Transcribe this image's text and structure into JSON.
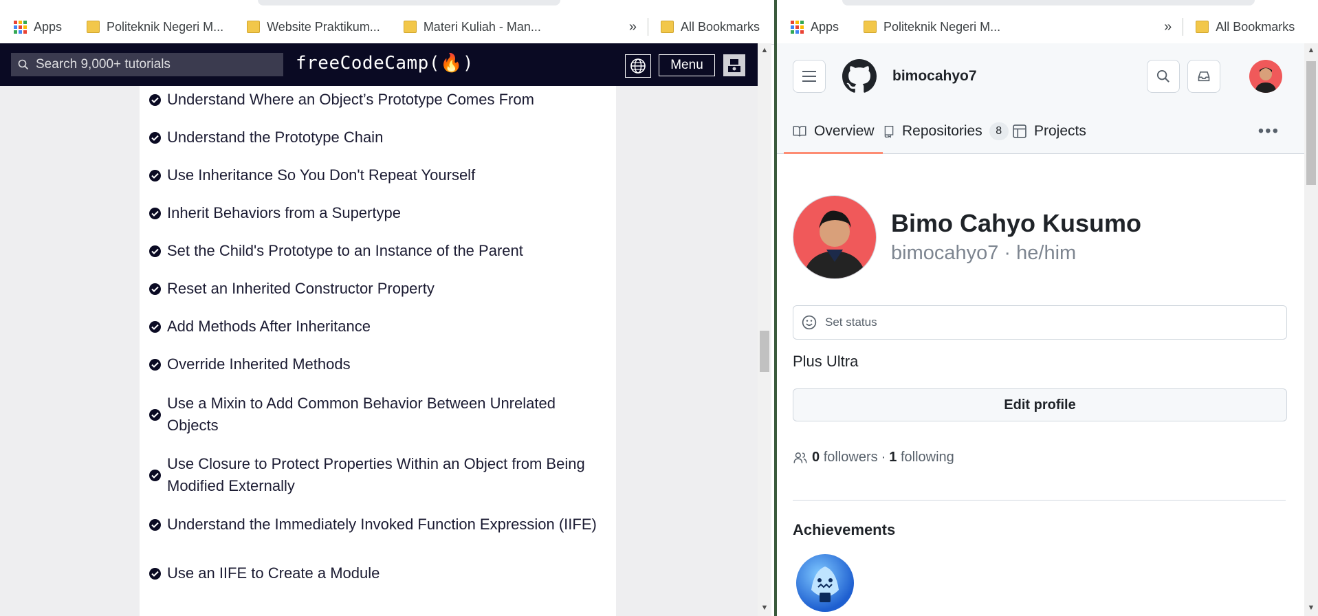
{
  "left_window": {
    "bookmarks": {
      "apps_label": "Apps",
      "items": [
        "Politeknik Negeri M...",
        "Website Praktikum...",
        "Materi Kuliah - Man..."
      ],
      "overflow": "»",
      "all_bookmarks": "All Bookmarks"
    },
    "fcc": {
      "search_placeholder": "Search 9,000+ tutorials",
      "logo_text": "freeCodeCamp(🔥)",
      "menu_label": "Menu",
      "lessons": [
        "Understand Where an Object’s Prototype Comes From",
        "Understand the Prototype Chain",
        "Use Inheritance So You Don't Repeat Yourself",
        "Inherit Behaviors from a Supertype",
        "Set the Child's Prototype to an Instance of the Parent",
        "Reset an Inherited Constructor Property",
        "Add Methods After Inheritance",
        "Override Inherited Methods",
        "Use a Mixin to Add Common Behavior Between Unrelated Objects",
        "Use Closure to Protect Properties Within an Object from Being Modified Externally",
        "Understand the Immediately Invoked Function Expression (IIFE)",
        "Use an IIFE to Create a Module"
      ]
    }
  },
  "right_window": {
    "bookmarks": {
      "apps_label": "Apps",
      "items": [
        "Politeknik Negeri M..."
      ],
      "overflow": "»",
      "all_bookmarks": "All Bookmarks"
    },
    "github": {
      "username": "bimocahyo7",
      "tabs": [
        {
          "label": "Overview",
          "icon": "book-icon",
          "selected": true
        },
        {
          "label": "Repositories",
          "icon": "repo-icon",
          "counter": "8"
        },
        {
          "label": "Projects",
          "icon": "table-icon"
        }
      ],
      "full_name": "Bimo Cahyo Kusumo",
      "handle": "bimocahyo7 · he/him",
      "status_placeholder": "Set status",
      "bio": "Plus Ultra",
      "edit_profile_label": "Edit profile",
      "followers_count": "0",
      "followers_label": "followers",
      "separator": "·",
      "following_count": "1",
      "following_label": "following",
      "achievements_title": "Achievements",
      "accent_color": "#fd8c73"
    }
  },
  "colors": {
    "fcc_nav_bg": "#0a0a23",
    "github_header_bg": "#f6f8fa",
    "avatar_bg": "#f0595a"
  }
}
